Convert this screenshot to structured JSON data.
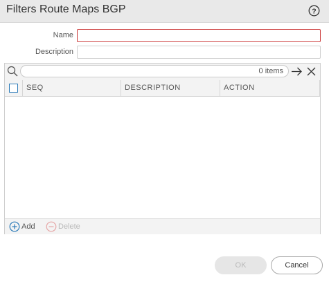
{
  "dialog": {
    "title": "Filters Route Maps BGP"
  },
  "form": {
    "name": {
      "label": "Name",
      "value": ""
    },
    "description": {
      "label": "Description",
      "value": ""
    }
  },
  "grid": {
    "search": {
      "value": "",
      "items_count": "0 items"
    },
    "columns": [
      "SEQ",
      "DESCRIPTION",
      "ACTION"
    ],
    "rows": [],
    "footer": {
      "add_label": "Add",
      "delete_label": "Delete"
    }
  },
  "buttons": {
    "ok": "OK",
    "cancel": "Cancel"
  },
  "colors": {
    "accent": "#2a7ab8",
    "invalid_border": "#cc3b3b",
    "disabled_text": "#b9b9b9"
  },
  "icons": {
    "help": "help-icon",
    "search": "search-icon",
    "apply": "arrow-right-icon",
    "clear": "close-icon",
    "add": "plus-circle-icon",
    "delete": "minus-circle-icon"
  }
}
